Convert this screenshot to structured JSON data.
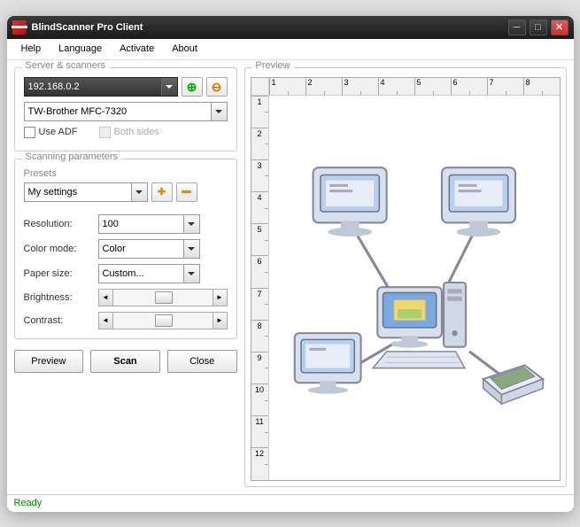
{
  "window": {
    "title": "BlindScanner Pro Client"
  },
  "menu": {
    "help": "Help",
    "language": "Language",
    "activate": "Activate",
    "about": "About"
  },
  "serverScanners": {
    "legend": "Server & scanners",
    "server": "192.168.0.2",
    "scanner": "TW-Brother MFC-7320",
    "useAdf": "Use ADF",
    "bothSides": "Both sides"
  },
  "scanningParams": {
    "legend": "Scanning parameters",
    "presetsLabel": "Presets",
    "preset": "My settings",
    "resolutionLabel": "Resolution:",
    "resolution": "100",
    "colorModeLabel": "Color mode:",
    "colorMode": "Color",
    "paperSizeLabel": "Paper size:",
    "paperSize": "Custom...",
    "brightnessLabel": "Brightness:",
    "contrastLabel": "Contrast:"
  },
  "buttons": {
    "preview": "Preview",
    "scan": "Scan",
    "close": "Close"
  },
  "preview": {
    "legend": "Preview",
    "rulerH": [
      "1",
      "2",
      "3",
      "4",
      "5",
      "6",
      "7",
      "8"
    ],
    "rulerV": [
      "1",
      "2",
      "3",
      "4",
      "5",
      "6",
      "7",
      "8",
      "9",
      "10",
      "11",
      "12"
    ]
  },
  "status": {
    "text": "Ready"
  }
}
